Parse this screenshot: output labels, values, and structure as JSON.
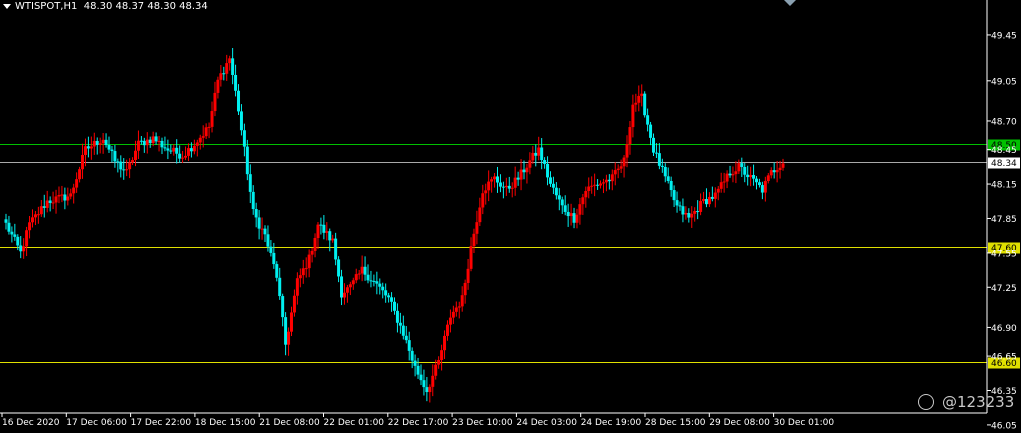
{
  "header": {
    "symbol_tf": "WTISPOT,H1",
    "ohlc": "48.30 48.37 48.30 48.34"
  },
  "watermark": {
    "handle": "@123233"
  },
  "colors": {
    "background": "#000000",
    "bull": "#ff0000",
    "bear": "#00f0f0",
    "green_line": "#00c000",
    "yellow_line": "#e0e000",
    "current_line": "#a9a9a9",
    "axis": "#ffffff"
  },
  "chart_data": {
    "type": "candlestick",
    "ylim": [
      46.18,
      49.65
    ],
    "y_ticks": [
      "49.45",
      "49.05",
      "48.70",
      "48.45",
      "48.15",
      "47.85",
      "47.55",
      "47.25",
      "46.90",
      "46.65",
      "46.35",
      "46.05"
    ],
    "x_ticks": [
      "16 Dec 2020",
      "17 Dec 06:00",
      "17 Dec 22:00",
      "18 Dec 15:00",
      "21 Dec 08:00",
      "22 Dec 01:00",
      "22 Dec 17:00",
      "23 Dec 10:00",
      "24 Dec 03:00",
      "24 Dec 19:00",
      "28 Dec 15:00",
      "29 Dec 08:00",
      "30 Dec 01:00"
    ],
    "levels": [
      {
        "value": "48.50",
        "color": "green"
      },
      {
        "value": "47.60",
        "color": "yellow"
      },
      {
        "value": "46.60",
        "color": "yellow"
      }
    ],
    "current_price": "48.34",
    "anchors": [
      [
        0,
        47.8
      ],
      [
        5,
        47.55
      ],
      [
        8,
        47.8
      ],
      [
        14,
        48.0
      ],
      [
        22,
        48.05
      ],
      [
        27,
        48.45
      ],
      [
        33,
        48.55
      ],
      [
        37,
        48.35
      ],
      [
        41,
        48.25
      ],
      [
        45,
        48.5
      ],
      [
        50,
        48.55
      ],
      [
        55,
        48.45
      ],
      [
        60,
        48.4
      ],
      [
        64,
        48.5
      ],
      [
        69,
        48.65
      ],
      [
        72,
        49.05
      ],
      [
        76,
        49.25
      ],
      [
        79,
        48.8
      ],
      [
        84,
        47.9
      ],
      [
        88,
        47.7
      ],
      [
        92,
        47.35
      ],
      [
        95,
        46.75
      ],
      [
        99,
        47.3
      ],
      [
        103,
        47.5
      ],
      [
        106,
        47.8
      ],
      [
        111,
        47.65
      ],
      [
        114,
        47.2
      ],
      [
        117,
        47.25
      ],
      [
        121,
        47.4
      ],
      [
        125,
        47.3
      ],
      [
        130,
        47.15
      ],
      [
        135,
        46.85
      ],
      [
        139,
        46.55
      ],
      [
        143,
        46.35
      ],
      [
        147,
        46.6
      ],
      [
        151,
        47.0
      ],
      [
        155,
        47.15
      ],
      [
        158,
        47.6
      ],
      [
        162,
        48.1
      ],
      [
        166,
        48.2
      ],
      [
        170,
        48.1
      ],
      [
        174,
        48.2
      ],
      [
        178,
        48.35
      ],
      [
        181,
        48.45
      ],
      [
        185,
        48.15
      ],
      [
        189,
        47.95
      ],
      [
        193,
        47.85
      ],
      [
        197,
        48.1
      ],
      [
        201,
        48.15
      ],
      [
        206,
        48.2
      ],
      [
        210,
        48.35
      ],
      [
        213,
        48.85
      ],
      [
        216,
        48.9
      ],
      [
        220,
        48.45
      ],
      [
        224,
        48.2
      ],
      [
        228,
        47.95
      ],
      [
        232,
        47.85
      ],
      [
        237,
        48.0
      ],
      [
        241,
        48.05
      ],
      [
        246,
        48.25
      ],
      [
        249,
        48.3
      ],
      [
        253,
        48.2
      ],
      [
        257,
        48.1
      ],
      [
        260,
        48.25
      ],
      [
        264,
        48.35
      ]
    ]
  }
}
